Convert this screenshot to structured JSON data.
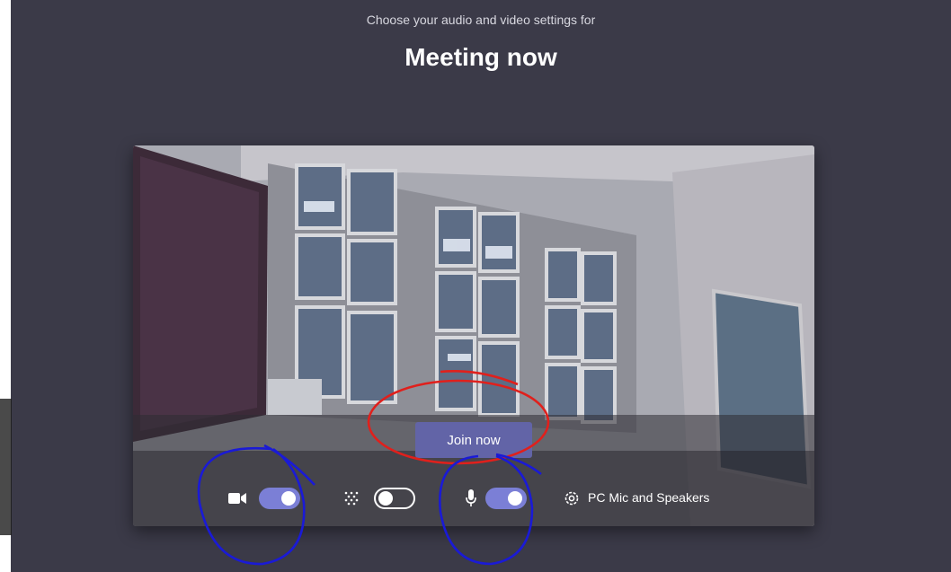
{
  "header": {
    "subtitle": "Choose your audio and video settings for",
    "meeting_title": "Meeting now"
  },
  "preview": {
    "join_button_label": "Join now"
  },
  "controls": {
    "camera_toggle_on": true,
    "background_blur_toggle_on": false,
    "microphone_toggle_on": true,
    "device_label": "PC Mic and Speakers",
    "icons": [
      "video-camera-icon",
      "background-blur-icon",
      "microphone-icon",
      "gear-icon"
    ]
  },
  "colors": {
    "background": "#3b3a48",
    "accent": "#6264a7",
    "toggle_on": "#7b7fd6",
    "annotation_red": "#e0201c",
    "annotation_blue": "#1a1ad6"
  }
}
